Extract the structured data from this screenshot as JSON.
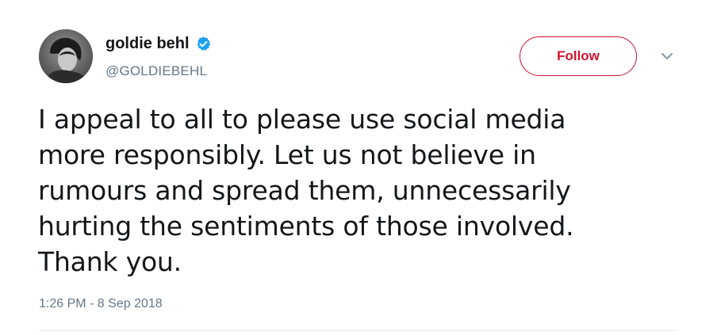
{
  "user": {
    "display_name": "goldie behl",
    "handle": "@GOLDIEBEHL",
    "verified": true
  },
  "follow_button": {
    "label": "Follow"
  },
  "tweet": {
    "text": "I appeal to all to please use social media\nmore responsibly. Let us not believe in\nrumours and spread them, unnecessarily\nhurting the sentiments of those involved.\nThank you.",
    "timestamp": "1:26 PM - 8 Sep 2018"
  },
  "icons": {
    "verified": "verified-badge-icon",
    "menu": "chevron-down-icon"
  },
  "colors": {
    "accent": "#d0122d",
    "verified_blue": "#1da1f2",
    "secondary_text": "#657786"
  }
}
